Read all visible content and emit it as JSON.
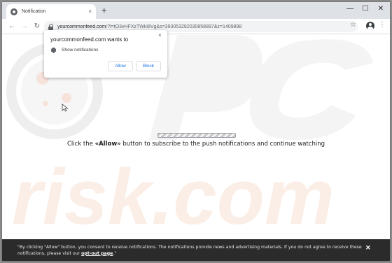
{
  "tab": {
    "title": "Notification",
    "close": "×"
  },
  "newtab": "+",
  "window_controls": {
    "minimize": "—",
    "maximize": "☐",
    "close": "✕"
  },
  "nav": {
    "back": "←",
    "forward": "→",
    "reload": "↻"
  },
  "omnibox": {
    "domain": "yourcommonfeed.com",
    "path": "/?l=tO3vHFXzTWkl8Vg&s=393053282030858897&z=1409898"
  },
  "toolbar_icons": {
    "star": "☆",
    "menu": "⋮"
  },
  "popup": {
    "title": "yourcommonfeed.com wants to",
    "permission": "Show notifications",
    "allow": "Allow",
    "block": "Block",
    "close": "×"
  },
  "message": {
    "before": "Click the ",
    "highlight": "«Allow»",
    "after": " button to subscribe to the push notifications and continue watching"
  },
  "consent": {
    "text": "\"By clicking \"Allow\" button, you consent to receive notifications. The notifications provide news and advertising materials. If you do not agree to receive these notifications, please visit our ",
    "link": "opt-out page",
    "end": ".\"",
    "close": "✕"
  },
  "watermark": {
    "text": "risk.com"
  },
  "colors": {
    "accent": "#1a73e8",
    "consent_bg": "#2b2b2b",
    "tabstrip": "#dee1e6"
  }
}
